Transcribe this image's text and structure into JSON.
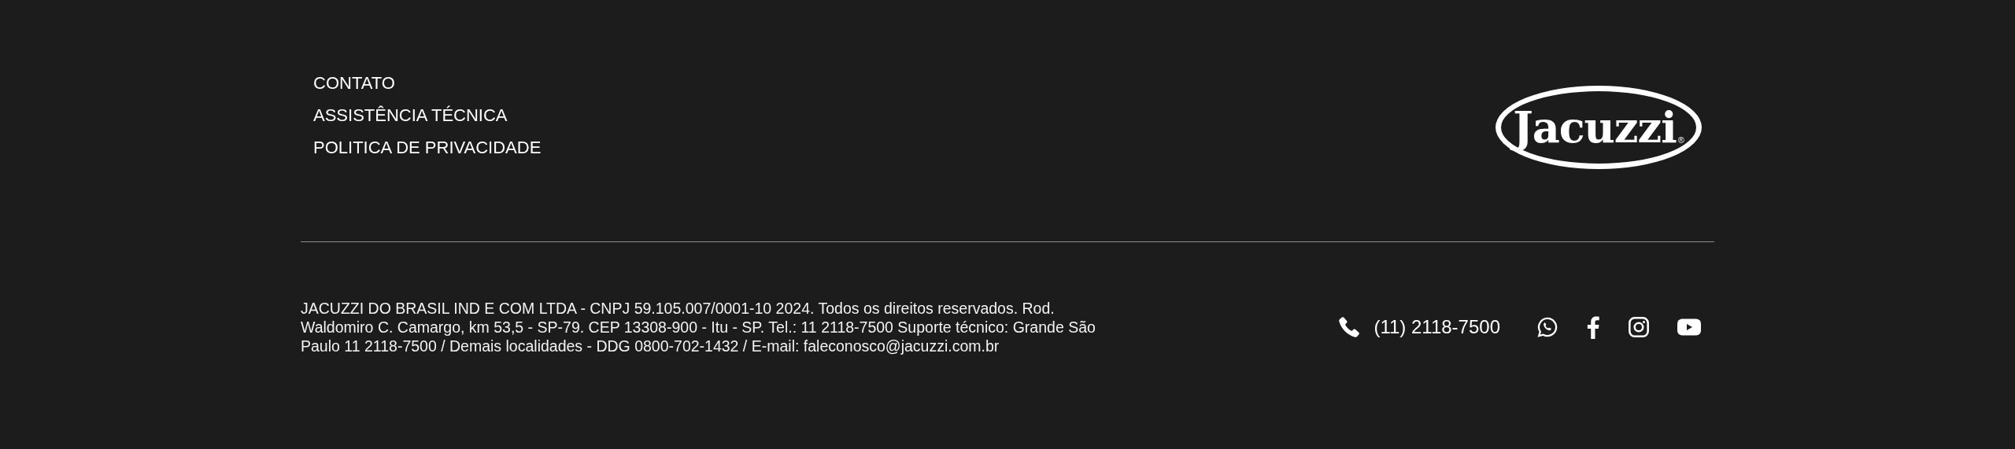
{
  "menu": [
    {
      "label": "CONTATO"
    },
    {
      "label": "ASSISTÊNCIA TÉCNICA"
    },
    {
      "label": "POLITICA DE PRIVACIDADE"
    }
  ],
  "logo": {
    "text": "Jacuzzi",
    "mark": "®"
  },
  "legal_text": "JACUZZI DO BRASIL IND E COM LTDA - CNPJ 59.105.007/0001-10 2024. Todos os direitos reservados. Rod. Waldomiro C. Camargo, km 53,5 - SP-79. CEP 13308-900 - Itu - SP. Tel.: 11 2118-7500 Suporte técnico: Grande São Paulo 11 2118-7500 / Demais localidades - DDG 0800-702-1432 / E-mail: faleconosco@jacuzzi.com.br",
  "phone": "(11) 2118-7500",
  "social": [
    {
      "kind": "whatsapp"
    },
    {
      "kind": "facebook"
    },
    {
      "kind": "instagram"
    },
    {
      "kind": "youtube"
    }
  ]
}
